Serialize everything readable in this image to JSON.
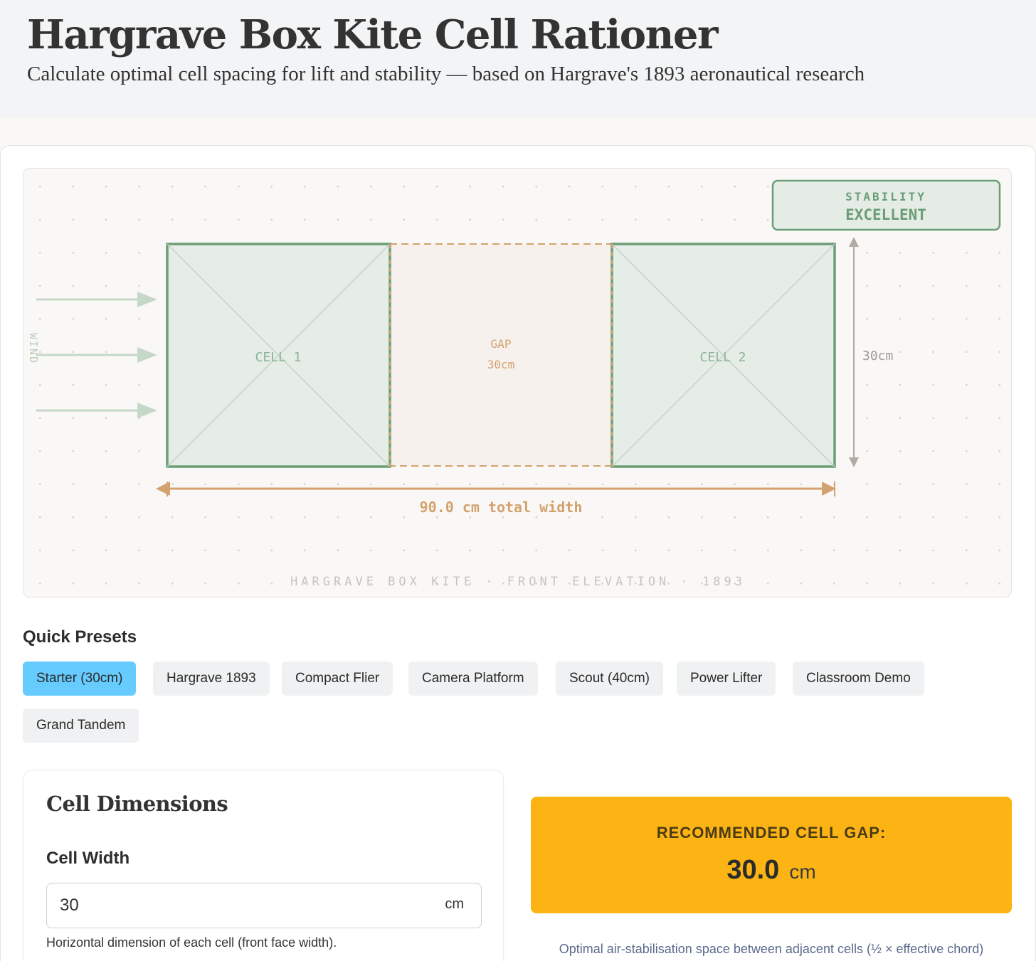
{
  "header": {
    "title": "Hargrave Box Kite Cell Rationer",
    "subtitle": "Calculate optimal cell spacing for lift and stability — based on Hargrave's 1893 aeronautical research"
  },
  "diagram": {
    "stability_label": "STABILITY",
    "stability_value": "EXCELLENT",
    "wind_label": "WIND",
    "cell1_label": "CELL 1",
    "cell2_label": "CELL 2",
    "gap_label": "GAP",
    "gap_value": "30cm",
    "height_label": "30cm",
    "total_width_label": "90.0 cm total width",
    "footer": "HARGRAVE BOX KITE · FRONT ELEVATION · 1893",
    "colors": {
      "cell_stroke": "#6a9e77",
      "cell_fill": "#e6ece6",
      "gap_stroke": "#d3a26e",
      "gap_fill": "#f6f1ec",
      "wind": "#c5d8c7",
      "dimension": "#b2aaa3"
    }
  },
  "presets": {
    "title": "Quick Presets",
    "items": [
      {
        "label": "Starter (30cm)",
        "active": true
      },
      {
        "label": "Hargrave 1893",
        "active": false
      },
      {
        "label": "Compact Flier",
        "active": false
      },
      {
        "label": "Camera Platform",
        "active": false
      },
      {
        "label": "Scout (40cm)",
        "active": false
      },
      {
        "label": "Power Lifter",
        "active": false
      },
      {
        "label": "Classroom Demo",
        "active": false
      },
      {
        "label": "Grand Tandem",
        "active": false
      }
    ]
  },
  "dimensions": {
    "title": "Cell Dimensions",
    "cell_width": {
      "label": "Cell Width",
      "value": "30",
      "unit": "cm",
      "help": "Horizontal dimension of each cell (front face width)."
    }
  },
  "result": {
    "label": "RECOMMENDED CELL GAP:",
    "value": "30.0",
    "unit": "cm",
    "note": "Optimal air-stabilisation space between adjacent cells (½ × effective chord)",
    "color": "#fcb414"
  }
}
